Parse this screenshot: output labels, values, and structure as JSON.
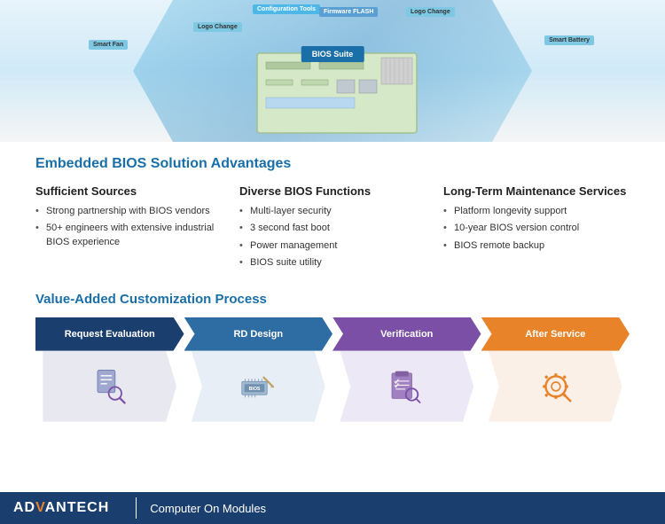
{
  "diagram": {
    "labels": {
      "bios_suite": "BIOS Suite",
      "smart_fan": "Smart Fan",
      "logo_change_left": "Logo Change",
      "config_tools": "Configuration Tools",
      "firmware_flash": "Firmware FLASH",
      "logo_change_right": "Logo Change",
      "smart_battery": "Smart Battery"
    }
  },
  "advantages": {
    "section_title": "Embedded BIOS Solution Advantages",
    "columns": [
      {
        "id": "sufficient-sources",
        "title": "Sufficient Sources",
        "items": [
          "Strong partnership with BIOS vendors",
          "50+ engineers with extensive industrial BIOS experience"
        ]
      },
      {
        "id": "diverse-bios",
        "title": "Diverse BIOS Functions",
        "items": [
          "Multi-layer security",
          "3 second fast boot",
          "Power management",
          "BIOS suite utility"
        ]
      },
      {
        "id": "long-term",
        "title": "Long-Term Maintenance Services",
        "items": [
          "Platform longevity support",
          "10-year BIOS version control",
          "BIOS remote backup"
        ]
      }
    ]
  },
  "process": {
    "title": "Value-Added Customization Process",
    "steps": [
      {
        "id": "request",
        "label": "Request Evaluation",
        "color": "dark-blue"
      },
      {
        "id": "rd",
        "label": "RD Design",
        "color": "medium-blue"
      },
      {
        "id": "verification",
        "label": "Verification",
        "color": "purple"
      },
      {
        "id": "after",
        "label": "After Service",
        "color": "orange"
      }
    ]
  },
  "footer": {
    "logo_prefix": "AD",
    "logo_highlight": "V",
    "logo_suffix": "ANTECH",
    "subtitle": "Computer On Modules"
  }
}
